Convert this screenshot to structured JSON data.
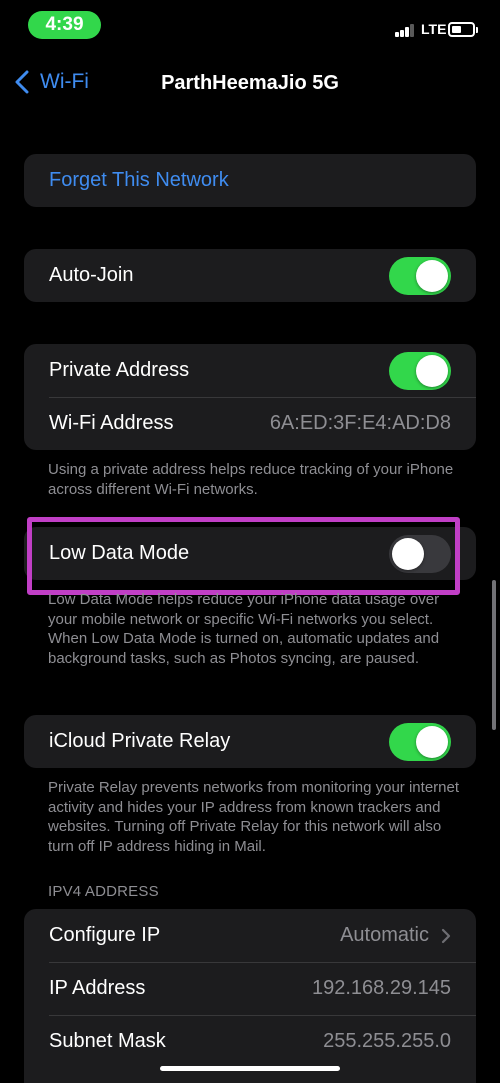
{
  "status": {
    "time": "4:39",
    "network": "LTE"
  },
  "nav": {
    "back_label": "Wi-Fi",
    "title": "ParthHeemaJio 5G"
  },
  "forget": {
    "label": "Forget This Network"
  },
  "auto_join": {
    "label": "Auto-Join",
    "on": true
  },
  "private": {
    "private_address_label": "Private Address",
    "private_address_on": true,
    "wifi_address_label": "Wi-Fi Address",
    "wifi_address_value": "6A:ED:3F:E4:AD:D8",
    "note": "Using a private address helps reduce tracking of your iPhone across different Wi-Fi networks."
  },
  "low_data": {
    "label": "Low Data Mode",
    "on": false,
    "note": "Low Data Mode helps reduce your iPhone data usage over your mobile network or specific Wi-Fi networks you select. When Low Data Mode is turned on, automatic updates and background tasks, such as Photos syncing, are paused."
  },
  "relay": {
    "label": "iCloud Private Relay",
    "on": true,
    "note": "Private Relay prevents networks from monitoring your internet activity and hides your IP address from known trackers and websites. Turning off Private Relay for this network will also turn off IP address hiding in Mail."
  },
  "ipv4": {
    "header": "IPV4 ADDRESS",
    "configure_ip_label": "Configure IP",
    "configure_ip_value": "Automatic",
    "ip_address_label": "IP Address",
    "ip_address_value": "192.168.29.145",
    "subnet_mask_label": "Subnet Mask",
    "subnet_mask_value": "255.255.255.0"
  },
  "colors": {
    "accent_blue": "#3f8cf0",
    "toggle_green": "#32d74b",
    "highlight": "#c13fc6"
  }
}
